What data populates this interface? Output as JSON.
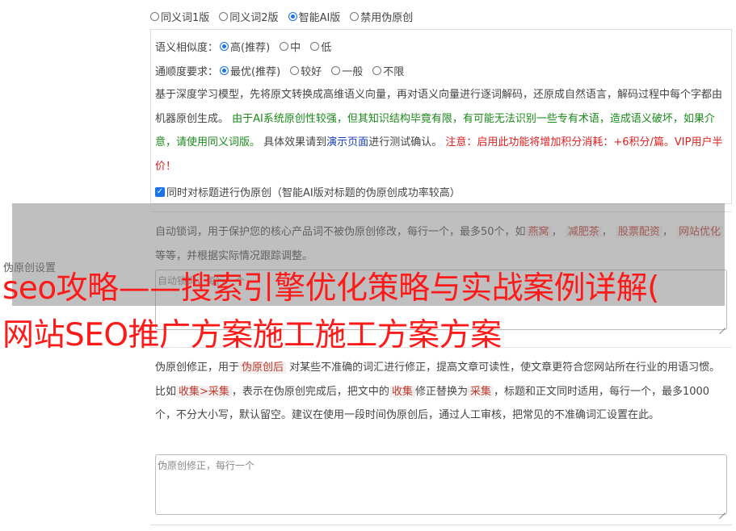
{
  "mode_options": [
    {
      "label": "同义词1版",
      "selected": false
    },
    {
      "label": "同义词2版",
      "selected": false
    },
    {
      "label": "智能AI版",
      "selected": true
    },
    {
      "label": "禁用伪原创",
      "selected": false
    }
  ],
  "similarity": {
    "label": "语义相似度：",
    "options": [
      {
        "label": "高(推荐)",
        "selected": true
      },
      {
        "label": "中",
        "selected": false
      },
      {
        "label": "低",
        "selected": false
      }
    ]
  },
  "fluency": {
    "label": "通顺度要求：",
    "options": [
      {
        "label": "最优(推荐)",
        "selected": true
      },
      {
        "label": "较好",
        "selected": false
      },
      {
        "label": "一般",
        "selected": false
      },
      {
        "label": "不限",
        "selected": false
      }
    ]
  },
  "ai_description": {
    "part1": "基于深度学习模型，先将原文转换成高维语义向量，再对语义向量进行逐词解码，还原成自然语言，解码过程中每个字都由机器原创生成。",
    "part2_green": "由于AI系统原创性较强，但其知识结构毕竟有限，有可能无法识别一些专有术语，造成语义破坏，如果介意，请使用同义词版。",
    "part3": "具体效果请到",
    "link": "演示页面",
    "part4": "进行测试确认。",
    "part5_red": "注意：启用此功能将增加积分消耗：+6积分/篇。VIP用户半价！"
  },
  "title_checkbox": {
    "checked": true,
    "label": "同时对标题进行伪原创（智能AI版对标题的伪原创成功率较高）"
  },
  "section_label": "伪原创设置",
  "lock_words": {
    "desc_before": "自动锁词，用于保护您的核心产品词不被伪原创修改，每行一个，最多50个，如",
    "examples": [
      "燕窝",
      "减肥茶",
      "股票配资",
      "网站优化"
    ],
    "desc_after": "等等，并根据实际情况跟踪调整。",
    "placeholder": "自动锁词，每行一个"
  },
  "correction": {
    "desc1": "伪原创修正，用于",
    "tag1": "伪原创后",
    "desc2": "对某些不准确的词汇进行修正，提高文章可读性，使文章更符合您网站所在行业的用语习惯。比如",
    "tag2": "收集>采集",
    "desc3": "，表示在伪原创完成后，把文中的",
    "tag3": "收集",
    "desc4": "修正替换为",
    "tag4": "采集",
    "desc5": "，标题和正文同时适用，每行一个，最多1000个，不分大小写，默认留空。建议在使用一段时间伪原创后，通过人工审核，把常见的不准确词汇设置在此。",
    "placeholder": "伪原创修正，每行一个"
  },
  "overlay_title": {
    "line1": "seo攻略——搜索引擎优化策略与实战案例详解(",
    "line2": "网站SEO推广方案施工施工方案方案"
  }
}
